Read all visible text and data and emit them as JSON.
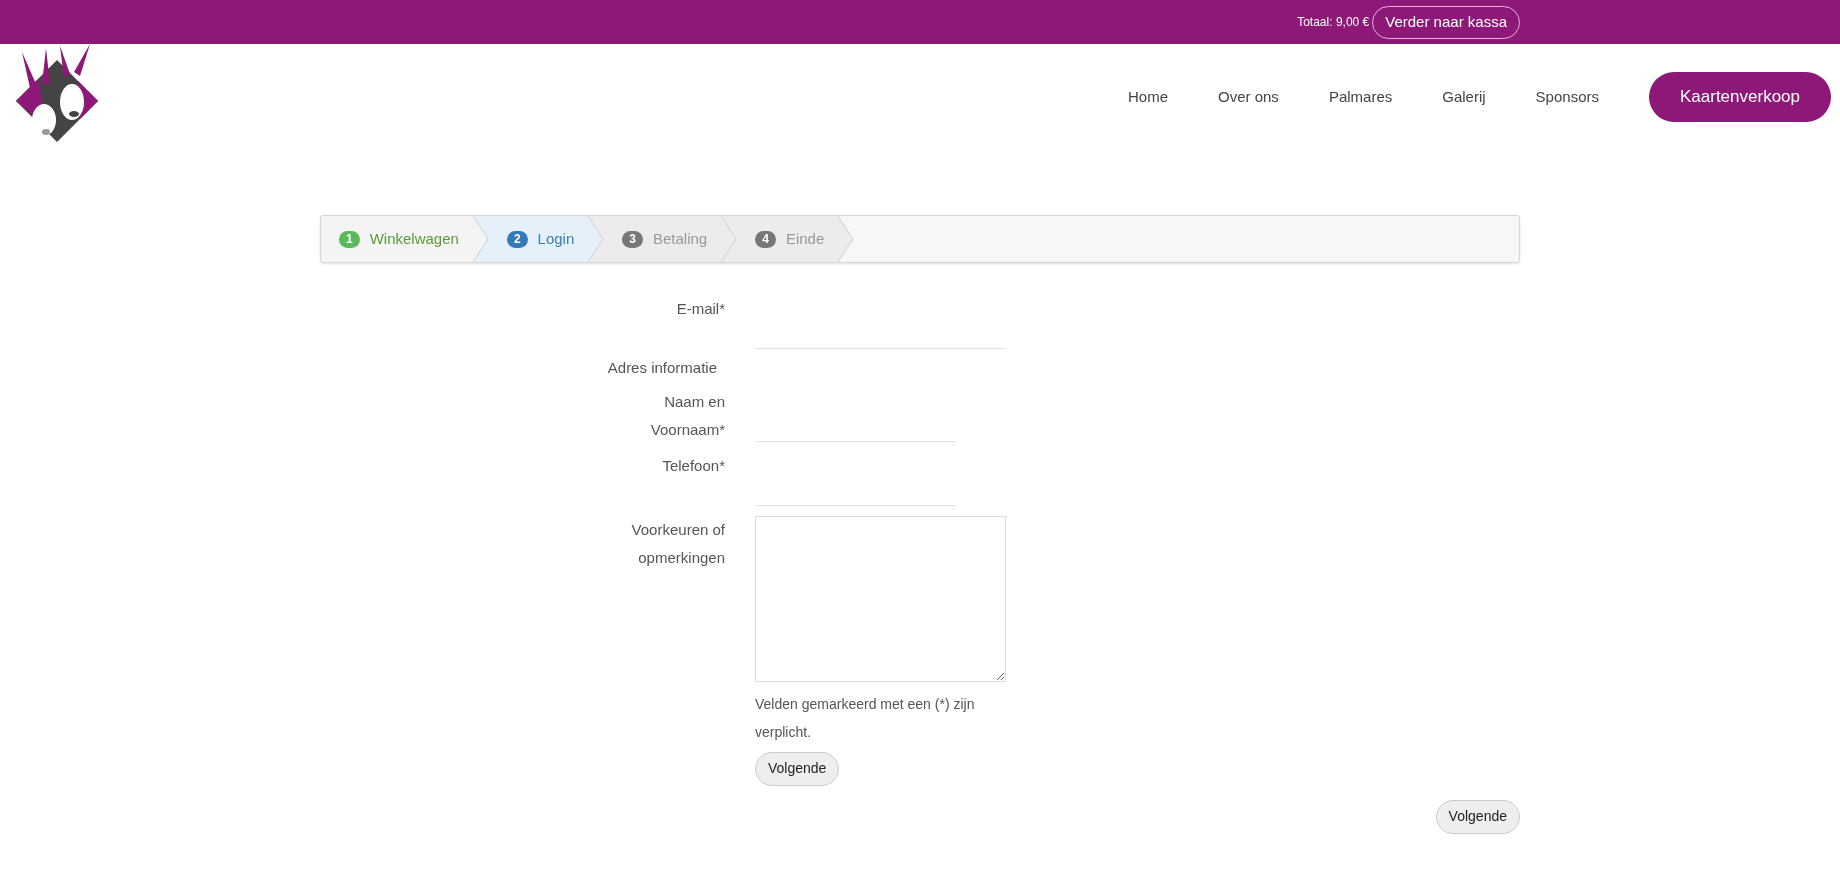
{
  "top_bar": {
    "total": "Totaal: 9,00 €",
    "checkout_button": "Verder naar kassa"
  },
  "nav": {
    "items": [
      {
        "label": "Home"
      },
      {
        "label": "Over ons"
      },
      {
        "label": "Palmares"
      },
      {
        "label": "Galerij"
      },
      {
        "label": "Sponsors"
      }
    ],
    "cta_button": "Kaartenverkoop"
  },
  "steps": [
    {
      "number": "1",
      "label": "Winkelwagen",
      "kind": "done",
      "selected": false
    },
    {
      "number": "2",
      "label": "Login",
      "kind": "current",
      "selected": true
    },
    {
      "number": "3",
      "label": "Betaling",
      "kind": "pending",
      "selected": false
    },
    {
      "number": "4",
      "label": "Einde",
      "kind": "pending",
      "selected": false
    }
  ],
  "form": {
    "rows": [
      {
        "kind": "text",
        "label": "E-mail*",
        "wide": true
      },
      {
        "kind": "heading",
        "label": "Adres informatie"
      },
      {
        "kind": "text",
        "label": "Naam en Voornaam*",
        "wide": false
      },
      {
        "kind": "text",
        "label": "Telefoon*",
        "wide": false
      },
      {
        "kind": "textarea",
        "label": "Voorkeuren of opmerkingen"
      }
    ],
    "note": "Velden gemarkeerd met een (*) zijn verplicht.",
    "submit_button": "Volgende"
  },
  "footer_button": "Volgende"
}
